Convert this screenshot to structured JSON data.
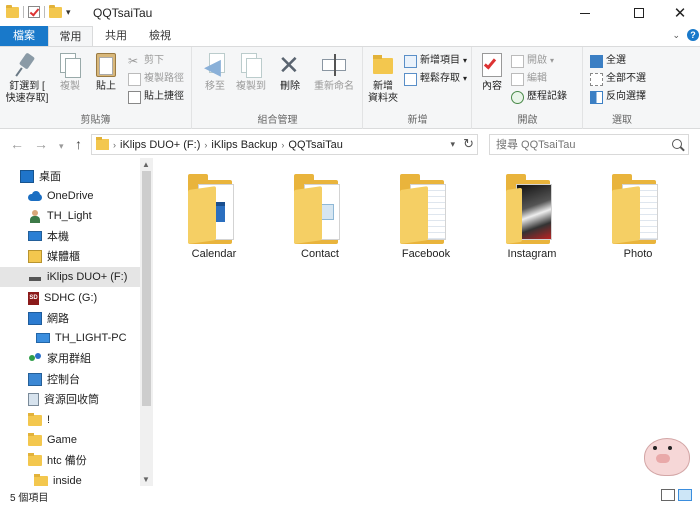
{
  "window": {
    "title": "QQTsaiTau",
    "controls": {
      "minimize": "—",
      "maximize": "☐",
      "close": "✕"
    }
  },
  "ribbon_tabs": {
    "file": "檔案",
    "home": "常用",
    "share": "共用",
    "view": "檢視"
  },
  "ribbon": {
    "clipboard": {
      "label": "剪貼簿",
      "pin_line1": "釘選到 [",
      "pin_line2": "快速存取]",
      "copy": "複製",
      "paste": "貼上",
      "cut": "剪下",
      "copy_path": "複製路徑",
      "paste_shortcut": "貼上捷徑"
    },
    "organize": {
      "label": "組合管理",
      "move_to": "移至",
      "copy_to": "複製到",
      "delete": "刪除",
      "rename": "重新命名"
    },
    "new": {
      "label": "新增",
      "new_folder_line1": "新增",
      "new_folder_line2": "資料夾",
      "new_item": "新增項目",
      "easy_access": "輕鬆存取"
    },
    "open": {
      "label": "開啟",
      "properties": "內容",
      "open": "開啟",
      "edit": "編輯",
      "history": "歷程記錄"
    },
    "select": {
      "label": "選取",
      "select_all": "全選",
      "select_none": "全部不選",
      "invert": "反向選擇"
    }
  },
  "address": {
    "crumbs": [
      "iKlips DUO+ (F:)",
      "iKlips Backup",
      "QQTsaiTau"
    ],
    "search_placeholder": "搜尋 QQTsaiTau"
  },
  "nav": {
    "items": [
      {
        "label": "桌面",
        "icon": "desktop-icon"
      },
      {
        "label": "OneDrive",
        "icon": "onedrive-icon"
      },
      {
        "label": "TH_Light",
        "icon": "user-icon"
      },
      {
        "label": "本機",
        "icon": "this-pc-icon"
      },
      {
        "label": "媒體櫃",
        "icon": "libraries-icon"
      },
      {
        "label": "iKlips DUO+ (F:)",
        "icon": "usb-drive-icon"
      },
      {
        "label": "SDHC (G:)",
        "icon": "sd-card-icon"
      },
      {
        "label": "網路",
        "icon": "network-icon"
      },
      {
        "label": "TH_LIGHT-PC",
        "icon": "computer-icon"
      },
      {
        "label": "家用群組",
        "icon": "homegroup-icon"
      },
      {
        "label": "控制台",
        "icon": "control-panel-icon"
      },
      {
        "label": "資源回收筒",
        "icon": "recycle-bin-icon"
      },
      {
        "label": "!",
        "icon": "folder-icon"
      },
      {
        "label": "Game",
        "icon": "folder-icon"
      },
      {
        "label": "htc 備份",
        "icon": "folder-icon"
      },
      {
        "label": "inside",
        "icon": "folder-icon"
      }
    ]
  },
  "files": [
    {
      "name": "Calendar",
      "thumb": "calendar",
      "accent": "#2b6fbf"
    },
    {
      "name": "Contact",
      "thumb": "contact",
      "accent": "#8fb8d6"
    },
    {
      "name": "Facebook",
      "thumb": "doc",
      "accent": "#c9d6e2"
    },
    {
      "name": "Instagram",
      "thumb": "photo",
      "accent": "#222222"
    },
    {
      "name": "Photo",
      "thumb": "doc",
      "accent": "#c9d6e2"
    }
  ],
  "status": {
    "count": "5 個項目"
  },
  "colors": {
    "file_tab": "#1979ca",
    "folder": "#f3c74e",
    "selection": "#e5e5e5"
  }
}
